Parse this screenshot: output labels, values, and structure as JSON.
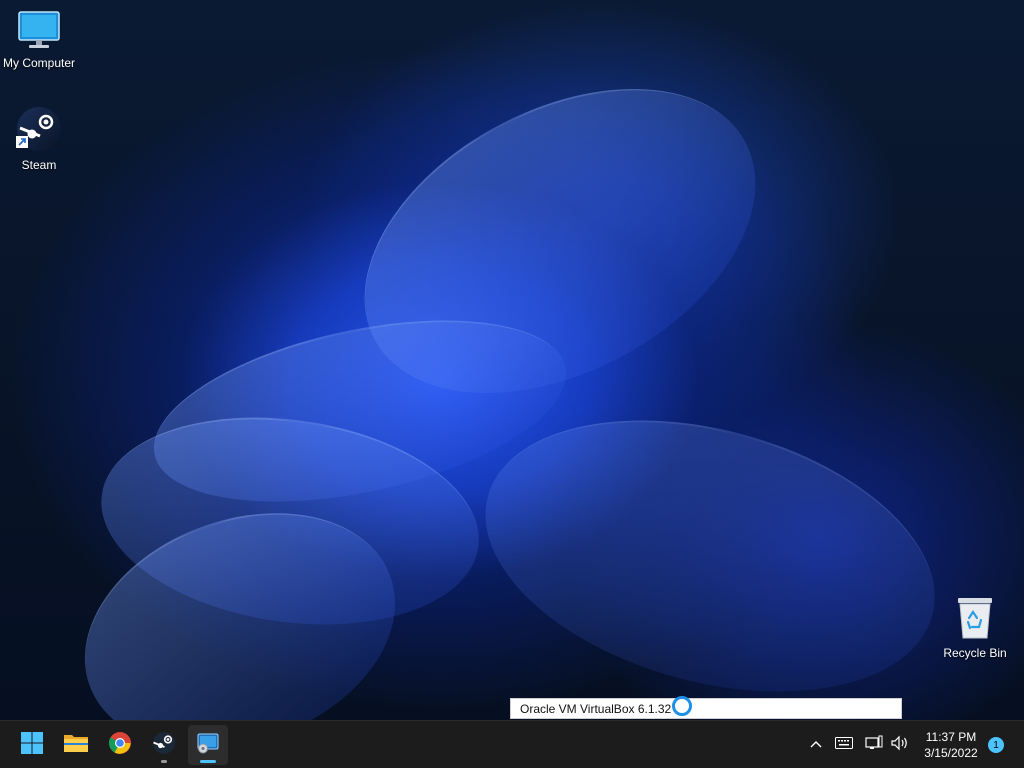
{
  "desktop": {
    "icons": [
      {
        "label": "My Computer",
        "icon": "monitor-icon"
      },
      {
        "label": "Steam",
        "icon": "steam-icon"
      },
      {
        "label": "Recycle Bin",
        "icon": "recycle-bin-icon"
      }
    ]
  },
  "tooltip": {
    "text": "Oracle VM VirtualBox 6.1.32"
  },
  "taskbar": {
    "apps": [
      {
        "name": "Start",
        "icon": "windows-logo-icon"
      },
      {
        "name": "File Explorer",
        "icon": "folder-icon"
      },
      {
        "name": "Google Chrome",
        "icon": "chrome-icon"
      },
      {
        "name": "Steam",
        "icon": "steam-icon"
      },
      {
        "name": "Oracle VM VirtualBox",
        "icon": "virtualbox-icon"
      }
    ],
    "tray": {
      "time": "11:37 PM",
      "date": "3/15/2022",
      "notification_count": "1"
    }
  },
  "colors": {
    "accent": "#4cc2ff",
    "taskbar_bg": "#1c1c1c",
    "wallpaper_blue": "#1f4fe8"
  }
}
